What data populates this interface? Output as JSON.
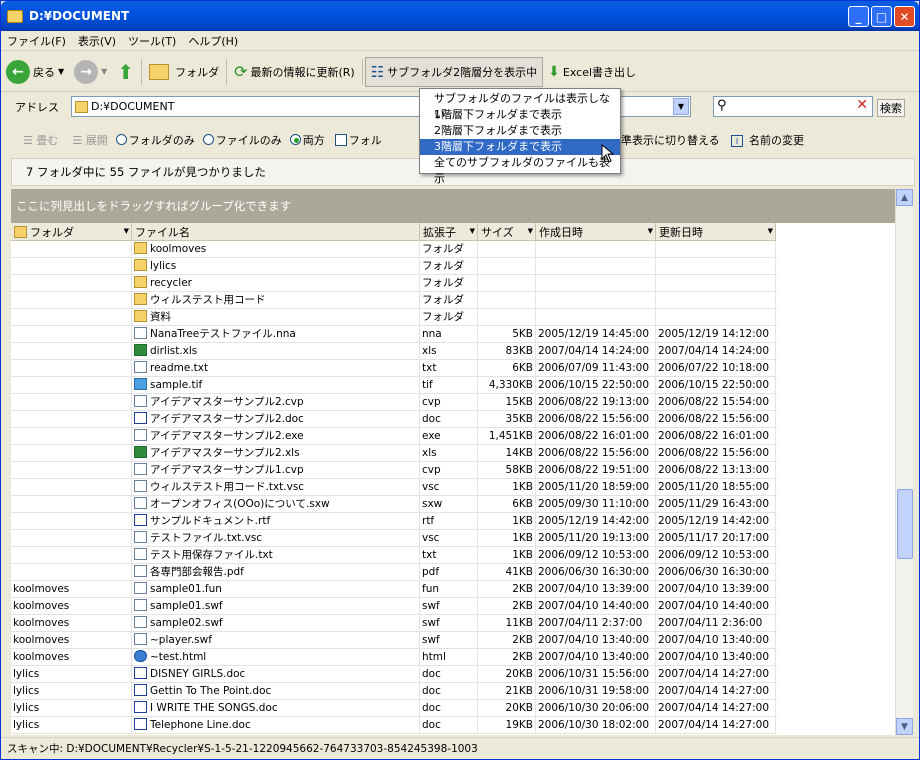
{
  "window": {
    "title": "D:¥DOCUMENT"
  },
  "menu": [
    "ファイル(F)",
    "表示(V)",
    "ツール(T)",
    "ヘルプ(H)"
  ],
  "toolbar": {
    "back": "戻る",
    "folder": "フォルダ",
    "refresh": "最新の情報に更新(R)",
    "subfolder": "サブフォルダ2階層分を表示中",
    "excel": "Excel書き出し"
  },
  "address": {
    "label": "アドレス",
    "value": "D:¥DOCUMENT",
    "search_button": "検索"
  },
  "viewbar": {
    "collapse": "畳む",
    "expand": "展開",
    "folders_only": "フォルダのみ",
    "files_only": "ファイルのみ",
    "both": "両方",
    "folder_check": "フォル",
    "switch_view": "準表示に切り替える",
    "rename": "名前の変更"
  },
  "dropdown": {
    "items": [
      "サブフォルダのファイルは表示しない",
      "1階層下フォルダまで表示",
      "2階層下フォルダまで表示",
      "3階層下フォルダまで表示",
      "全てのサブフォルダのファイルも表示"
    ],
    "selected_index": 3
  },
  "result_text": "7 フォルダ中に 55 ファイルが見つかりました",
  "group_hint": "ここに列見出しをドラッグすればグループ化できます",
  "columns": [
    "フォルダ",
    "ファイル名",
    "拡張子",
    "サイズ",
    "作成日時",
    "更新日時"
  ],
  "rows": [
    {
      "folder": "",
      "name": "koolmoves",
      "ext": "フォルダ",
      "size": "",
      "created": "",
      "modified": "",
      "icon": "folder"
    },
    {
      "folder": "",
      "name": "lylics",
      "ext": "フォルダ",
      "size": "",
      "created": "",
      "modified": "",
      "icon": "folder"
    },
    {
      "folder": "",
      "name": "recycler",
      "ext": "フォルダ",
      "size": "",
      "created": "",
      "modified": "",
      "icon": "folder"
    },
    {
      "folder": "",
      "name": "ウィルステスト用コード",
      "ext": "フォルダ",
      "size": "",
      "created": "",
      "modified": "",
      "icon": "folder"
    },
    {
      "folder": "",
      "name": "資料",
      "ext": "フォルダ",
      "size": "",
      "created": "",
      "modified": "",
      "icon": "folder"
    },
    {
      "folder": "",
      "name": "NanaTreeテストファイル.nna",
      "ext": "nna",
      "size": "5KB",
      "created": "2005/12/19 14:45:00",
      "modified": "2005/12/19 14:12:00",
      "icon": "file"
    },
    {
      "folder": "",
      "name": "dirlist.xls",
      "ext": "xls",
      "size": "83KB",
      "created": "2007/04/14 14:24:00",
      "modified": "2007/04/14 14:24:00",
      "icon": "xls"
    },
    {
      "folder": "",
      "name": "readme.txt",
      "ext": "txt",
      "size": "6KB",
      "created": "2006/07/09 11:43:00",
      "modified": "2006/07/22 10:18:00",
      "icon": "file"
    },
    {
      "folder": "",
      "name": "sample.tif",
      "ext": "tif",
      "size": "4,330KB",
      "created": "2006/10/15 22:50:00",
      "modified": "2006/10/15 22:50:00",
      "icon": "img"
    },
    {
      "folder": "",
      "name": "アイデアマスターサンプル2.cvp",
      "ext": "cvp",
      "size": "15KB",
      "created": "2006/08/22 19:13:00",
      "modified": "2006/08/22 15:54:00",
      "icon": "file"
    },
    {
      "folder": "",
      "name": "アイデアマスターサンプル2.doc",
      "ext": "doc",
      "size": "35KB",
      "created": "2006/08/22 15:56:00",
      "modified": "2006/08/22 15:56:00",
      "icon": "doc"
    },
    {
      "folder": "",
      "name": "アイデアマスターサンプル2.exe",
      "ext": "exe",
      "size": "1,451KB",
      "created": "2006/08/22 16:01:00",
      "modified": "2006/08/22 16:01:00",
      "icon": "file"
    },
    {
      "folder": "",
      "name": "アイデアマスターサンプル2.xls",
      "ext": "xls",
      "size": "14KB",
      "created": "2006/08/22 15:56:00",
      "modified": "2006/08/22 15:56:00",
      "icon": "xls"
    },
    {
      "folder": "",
      "name": "アイデアマスターサンプル1.cvp",
      "ext": "cvp",
      "size": "58KB",
      "created": "2006/08/22 19:51:00",
      "modified": "2006/08/22 13:13:00",
      "icon": "file"
    },
    {
      "folder": "",
      "name": "ウィルステスト用コード.txt.vsc",
      "ext": "vsc",
      "size": "1KB",
      "created": "2005/11/20 18:59:00",
      "modified": "2005/11/20 18:55:00",
      "icon": "file"
    },
    {
      "folder": "",
      "name": "オープンオフィス(OOo)について.sxw",
      "ext": "sxw",
      "size": "6KB",
      "created": "2005/09/30 11:10:00",
      "modified": "2005/11/29 16:43:00",
      "icon": "file"
    },
    {
      "folder": "",
      "name": "サンプルドキュメント.rtf",
      "ext": "rtf",
      "size": "1KB",
      "created": "2005/12/19 14:42:00",
      "modified": "2005/12/19 14:42:00",
      "icon": "doc"
    },
    {
      "folder": "",
      "name": "テストファイル.txt.vsc",
      "ext": "vsc",
      "size": "1KB",
      "created": "2005/11/20 19:13:00",
      "modified": "2005/11/17 20:17:00",
      "icon": "file"
    },
    {
      "folder": "",
      "name": "テスト用保存ファイル.txt",
      "ext": "txt",
      "size": "1KB",
      "created": "2006/09/12 10:53:00",
      "modified": "2006/09/12 10:53:00",
      "icon": "file"
    },
    {
      "folder": "",
      "name": "各専門部会報告.pdf",
      "ext": "pdf",
      "size": "41KB",
      "created": "2006/06/30 16:30:00",
      "modified": "2006/06/30 16:30:00",
      "icon": "file"
    },
    {
      "folder": "koolmoves",
      "name": "sample01.fun",
      "ext": "fun",
      "size": "2KB",
      "created": "2007/04/10 13:39:00",
      "modified": "2007/04/10 13:39:00",
      "icon": "file"
    },
    {
      "folder": "koolmoves",
      "name": "sample01.swf",
      "ext": "swf",
      "size": "2KB",
      "created": "2007/04/10 14:40:00",
      "modified": "2007/04/10 14:40:00",
      "icon": "file"
    },
    {
      "folder": "koolmoves",
      "name": "sample02.swf",
      "ext": "swf",
      "size": "11KB",
      "created": "2007/04/11 2:37:00",
      "modified": "2007/04/11 2:36:00",
      "icon": "file"
    },
    {
      "folder": "koolmoves",
      "name": "~player.swf",
      "ext": "swf",
      "size": "2KB",
      "created": "2007/04/10 13:40:00",
      "modified": "2007/04/10 13:40:00",
      "icon": "file"
    },
    {
      "folder": "koolmoves",
      "name": "~test.html",
      "ext": "html",
      "size": "2KB",
      "created": "2007/04/10 13:40:00",
      "modified": "2007/04/10 13:40:00",
      "icon": "html"
    },
    {
      "folder": "lylics",
      "name": "DISNEY GIRLS.doc",
      "ext": "doc",
      "size": "20KB",
      "created": "2006/10/31 15:56:00",
      "modified": "2007/04/14 14:27:00",
      "icon": "doc"
    },
    {
      "folder": "lylics",
      "name": "Gettin To The Point.doc",
      "ext": "doc",
      "size": "21KB",
      "created": "2006/10/31 19:58:00",
      "modified": "2007/04/14 14:27:00",
      "icon": "doc"
    },
    {
      "folder": "lylics",
      "name": "I WRITE THE SONGS.doc",
      "ext": "doc",
      "size": "20KB",
      "created": "2006/10/30 20:06:00",
      "modified": "2007/04/14 14:27:00",
      "icon": "doc"
    },
    {
      "folder": "lylics",
      "name": "Telephone Line.doc",
      "ext": "doc",
      "size": "19KB",
      "created": "2006/10/30 18:02:00",
      "modified": "2007/04/14 14:27:00",
      "icon": "doc"
    }
  ],
  "statusbar": "スキャン中: D:¥DOCUMENT¥Recycler¥S-1-5-21-1220945662-764733703-854245398-1003"
}
